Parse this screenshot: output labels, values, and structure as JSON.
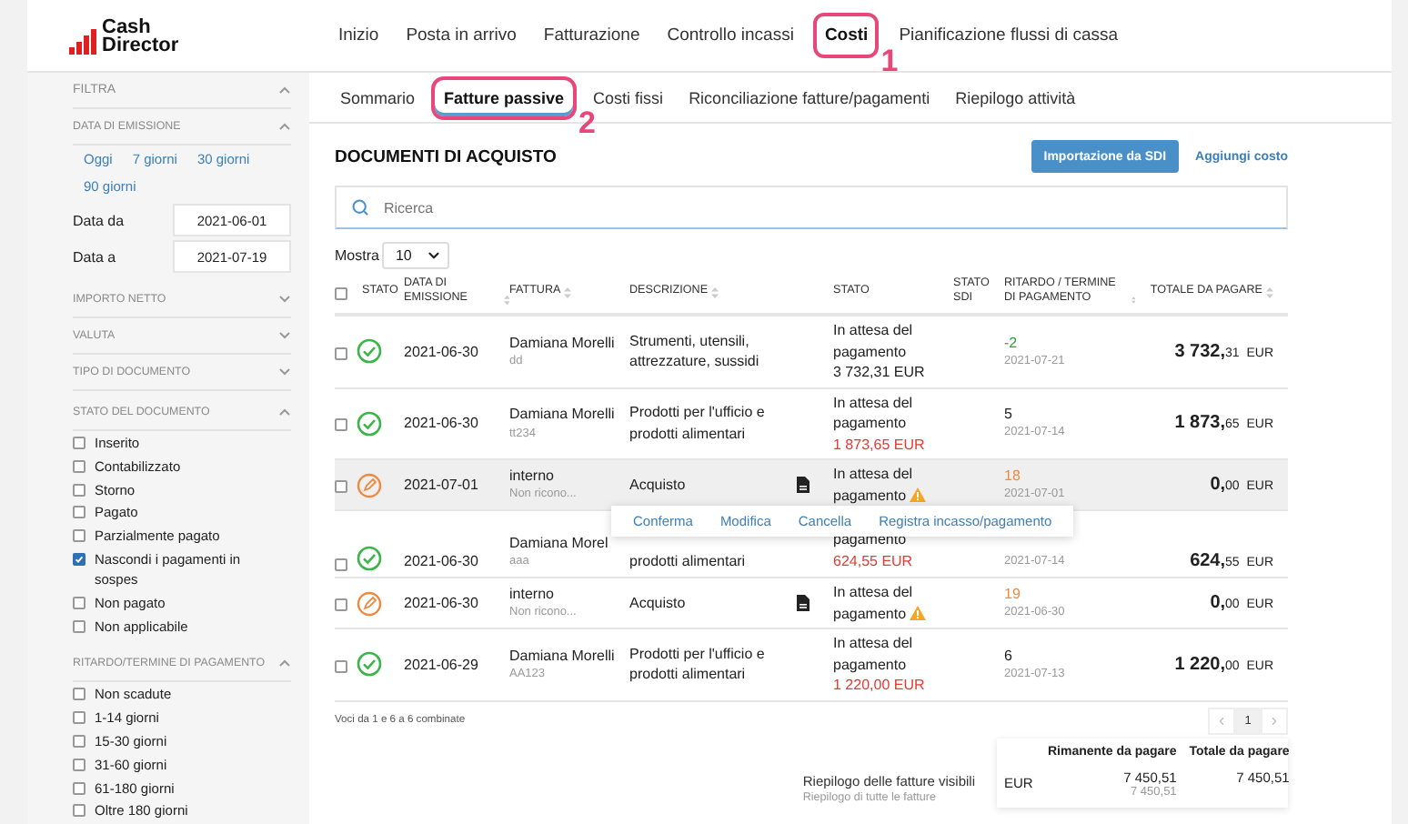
{
  "brand": {
    "line1": "Cash",
    "line2": "Director"
  },
  "nav": [
    {
      "label": "Inizio",
      "selected": false
    },
    {
      "label": "Posta in arrivo",
      "selected": false
    },
    {
      "label": "Fatturazione",
      "selected": false
    },
    {
      "label": "Controllo incassi",
      "selected": false
    },
    {
      "label": "Costi",
      "selected": true,
      "callout": "1"
    },
    {
      "label": "Pianificazione flussi di cassa",
      "selected": false
    }
  ],
  "subtabs": [
    {
      "label": "Sommario",
      "selected": false
    },
    {
      "label": "Fatture passive",
      "selected": true,
      "callout": "2"
    },
    {
      "label": "Costi fissi",
      "selected": false
    },
    {
      "label": "Riconciliazione fatture/pagamenti",
      "selected": false
    },
    {
      "label": "Riepilogo attività",
      "selected": false
    }
  ],
  "filters": {
    "title": "FILTRA",
    "expanded": true,
    "sections": [
      {
        "title": "DATA DI EMISSIONE",
        "expanded": true,
        "quick_ranges": [
          "Oggi",
          "7 giorni",
          "30 giorni",
          "90 giorni"
        ],
        "dates": [
          {
            "label": "Data da",
            "value": "2021-06-01"
          },
          {
            "label": "Data a",
            "value": "2021-07-19"
          }
        ]
      },
      {
        "title": "IMPORTO NETTO",
        "expanded": false
      },
      {
        "title": "VALUTA",
        "expanded": false
      },
      {
        "title": "TIPO DI DOCUMENTO",
        "expanded": false
      },
      {
        "title": "STATO DEL DOCUMENTO",
        "expanded": true,
        "options": [
          {
            "label": "Inserito",
            "checked": false
          },
          {
            "label": "Contabilizzato",
            "checked": false
          },
          {
            "label": "Storno",
            "checked": false
          },
          {
            "label": "Pagato",
            "checked": false
          },
          {
            "label": "Parzialmente pagato",
            "checked": false
          },
          {
            "label": "Nascondi i pagamenti in sospes",
            "checked": true
          },
          {
            "label": "Non pagato",
            "checked": false
          },
          {
            "label": "Non applicabile",
            "checked": false
          }
        ]
      },
      {
        "title": "RITARDO/TERMINE DI PAGAMENTO",
        "expanded": true,
        "options": [
          {
            "label": "Non scadute",
            "checked": false
          },
          {
            "label": "1-14 giorni",
            "checked": false
          },
          {
            "label": "15-30 giorni",
            "checked": false
          },
          {
            "label": "31-60 giorni",
            "checked": false
          },
          {
            "label": "61-180 giorni",
            "checked": false
          },
          {
            "label": "Oltre 180 giorni",
            "checked": false
          }
        ]
      }
    ]
  },
  "documents": {
    "title": "DOCUMENTI DI ACQUISTO",
    "primary_button": "Importazione da SDI",
    "link": "Aggiungi costo",
    "search": {
      "placeholder": "Ricerca"
    },
    "page_size": {
      "label": "Mostra",
      "value": "10"
    },
    "select_all": {
      "checked": false
    },
    "columns": [
      {
        "label": "STATO",
        "sortable": false
      },
      {
        "label": "DATA DI EMISSIONE",
        "sortable": true
      },
      {
        "label": "FATTURA",
        "sortable": true
      },
      {
        "label": "DESCRIZIONE",
        "sortable": true
      },
      {
        "label": "STATO",
        "sortable": false
      },
      {
        "label": "STATO SDI",
        "sortable": false
      },
      {
        "label": "RITARDO / TERMINE DI PAGAMENTO",
        "sortable": true
      },
      {
        "label": "TOTALE DA PAGARE",
        "sortable": true
      }
    ],
    "rows": [
      {
        "checked": false,
        "hovered": false,
        "kind": "confirmed",
        "date": "2021-06-30",
        "supplier": "Damiana Morelli",
        "ref": "dd",
        "description": "Strumenti, utensili, attrezzature, sussidi",
        "has_document": false,
        "state": "In attesa del pagamento",
        "warning": false,
        "amount": "3 732,31 EUR",
        "overdue": false,
        "delay": {
          "text": "-2",
          "color": "#2e9e3e"
        },
        "due": "2021-07-21",
        "total": {
          "whole": "3 732,",
          "cents": "31",
          "currency": "EUR"
        }
      },
      {
        "checked": false,
        "hovered": false,
        "kind": "confirmed",
        "date": "2021-06-30",
        "supplier": "Damiana Morelli",
        "ref": "tt234",
        "description": "Prodotti per l'ufficio e prodotti alimentari",
        "has_document": false,
        "state": "In attesa del pagamento",
        "warning": false,
        "amount": "1 873,65 EUR",
        "overdue": true,
        "delay": {
          "text": "5",
          "color": "#222222"
        },
        "due": "2021-07-14",
        "total": {
          "whole": "1 873,",
          "cents": "65",
          "currency": "EUR"
        }
      },
      {
        "checked": false,
        "hovered": true,
        "kind": "draft",
        "date": "2021-07-01",
        "supplier": "interno",
        "ref": "Non ricono...",
        "description": "Acquisto",
        "has_document": true,
        "state": "In attesa del pagamento",
        "warning": true,
        "delay": {
          "text": "18",
          "color": "#f0883e"
        },
        "due": "2021-07-01",
        "total": {
          "whole": "0,",
          "cents": "00",
          "currency": "EUR"
        },
        "actions": [
          "Conferma",
          "Modifica",
          "Cancella",
          "Registra incasso/pagamento"
        ]
      },
      {
        "checked": false,
        "hovered": false,
        "kind": "confirmed",
        "date": "2021-06-30",
        "supplier": "Damiana Morel",
        "ref": "aaa",
        "description": "prodotti alimentari",
        "has_document": false,
        "state": "pagamento",
        "warning": false,
        "amount": "624,55 EUR",
        "overdue": true,
        "due": "2021-07-14",
        "total": {
          "whole": "624,",
          "cents": "55",
          "currency": "EUR"
        }
      },
      {
        "checked": false,
        "hovered": false,
        "kind": "draft",
        "date": "2021-06-30",
        "supplier": "interno",
        "ref": "Non ricono...",
        "description": "Acquisto",
        "has_document": true,
        "state": "In attesa del pagamento",
        "warning": true,
        "delay": {
          "text": "19",
          "color": "#f0883e"
        },
        "due": "2021-06-30",
        "total": {
          "whole": "0,",
          "cents": "00",
          "currency": "EUR"
        }
      },
      {
        "checked": false,
        "hovered": false,
        "kind": "confirmed",
        "date": "2021-06-29",
        "supplier": "Damiana Morelli",
        "ref": "AA123",
        "description": "Prodotti per l'ufficio e prodotti alimentari",
        "has_document": false,
        "state": "In attesa del pagamento",
        "warning": false,
        "amount": "1 220,00 EUR",
        "overdue": true,
        "delay": {
          "text": "6",
          "color": "#222222"
        },
        "due": "2021-07-13",
        "total": {
          "whole": "1 220,",
          "cents": "00",
          "currency": "EUR"
        }
      }
    ],
    "footer": "Voci da 1 e 6 a 6 combinate",
    "pages": [
      {
        "label": "1",
        "selected": true
      }
    ],
    "summary": {
      "label": "Riepilogo delle fatture visibili",
      "sublabel": "Riepilogo di tutte le fatture",
      "columns": [
        "Rimanente da pagare",
        "Totale da pagare"
      ],
      "currency": "EUR",
      "remaining": "7 450,51",
      "remaining_all": "7 450,51",
      "total": "7 450,51"
    }
  }
}
